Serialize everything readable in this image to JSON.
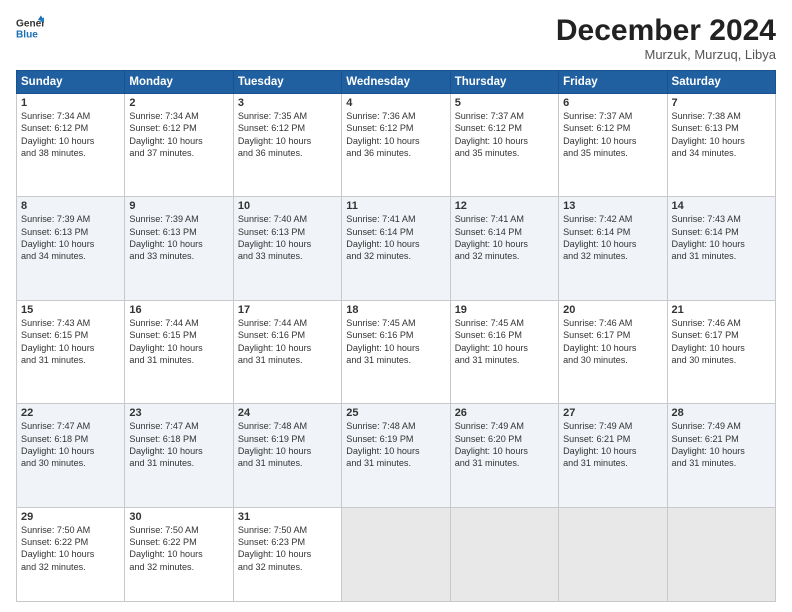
{
  "logo": {
    "line1": "General",
    "line2": "Blue"
  },
  "title": "December 2024",
  "location": "Murzuk, Murzuq, Libya",
  "days_header": [
    "Sunday",
    "Monday",
    "Tuesday",
    "Wednesday",
    "Thursday",
    "Friday",
    "Saturday"
  ],
  "weeks": [
    [
      {
        "day": "1",
        "info": "Sunrise: 7:34 AM\nSunset: 6:12 PM\nDaylight: 10 hours\nand 38 minutes."
      },
      {
        "day": "2",
        "info": "Sunrise: 7:34 AM\nSunset: 6:12 PM\nDaylight: 10 hours\nand 37 minutes."
      },
      {
        "day": "3",
        "info": "Sunrise: 7:35 AM\nSunset: 6:12 PM\nDaylight: 10 hours\nand 36 minutes."
      },
      {
        "day": "4",
        "info": "Sunrise: 7:36 AM\nSunset: 6:12 PM\nDaylight: 10 hours\nand 36 minutes."
      },
      {
        "day": "5",
        "info": "Sunrise: 7:37 AM\nSunset: 6:12 PM\nDaylight: 10 hours\nand 35 minutes."
      },
      {
        "day": "6",
        "info": "Sunrise: 7:37 AM\nSunset: 6:12 PM\nDaylight: 10 hours\nand 35 minutes."
      },
      {
        "day": "7",
        "info": "Sunrise: 7:38 AM\nSunset: 6:13 PM\nDaylight: 10 hours\nand 34 minutes."
      }
    ],
    [
      {
        "day": "8",
        "info": "Sunrise: 7:39 AM\nSunset: 6:13 PM\nDaylight: 10 hours\nand 34 minutes."
      },
      {
        "day": "9",
        "info": "Sunrise: 7:39 AM\nSunset: 6:13 PM\nDaylight: 10 hours\nand 33 minutes."
      },
      {
        "day": "10",
        "info": "Sunrise: 7:40 AM\nSunset: 6:13 PM\nDaylight: 10 hours\nand 33 minutes."
      },
      {
        "day": "11",
        "info": "Sunrise: 7:41 AM\nSunset: 6:14 PM\nDaylight: 10 hours\nand 32 minutes."
      },
      {
        "day": "12",
        "info": "Sunrise: 7:41 AM\nSunset: 6:14 PM\nDaylight: 10 hours\nand 32 minutes."
      },
      {
        "day": "13",
        "info": "Sunrise: 7:42 AM\nSunset: 6:14 PM\nDaylight: 10 hours\nand 32 minutes."
      },
      {
        "day": "14",
        "info": "Sunrise: 7:43 AM\nSunset: 6:14 PM\nDaylight: 10 hours\nand 31 minutes."
      }
    ],
    [
      {
        "day": "15",
        "info": "Sunrise: 7:43 AM\nSunset: 6:15 PM\nDaylight: 10 hours\nand 31 minutes."
      },
      {
        "day": "16",
        "info": "Sunrise: 7:44 AM\nSunset: 6:15 PM\nDaylight: 10 hours\nand 31 minutes."
      },
      {
        "day": "17",
        "info": "Sunrise: 7:44 AM\nSunset: 6:16 PM\nDaylight: 10 hours\nand 31 minutes."
      },
      {
        "day": "18",
        "info": "Sunrise: 7:45 AM\nSunset: 6:16 PM\nDaylight: 10 hours\nand 31 minutes."
      },
      {
        "day": "19",
        "info": "Sunrise: 7:45 AM\nSunset: 6:16 PM\nDaylight: 10 hours\nand 31 minutes."
      },
      {
        "day": "20",
        "info": "Sunrise: 7:46 AM\nSunset: 6:17 PM\nDaylight: 10 hours\nand 30 minutes."
      },
      {
        "day": "21",
        "info": "Sunrise: 7:46 AM\nSunset: 6:17 PM\nDaylight: 10 hours\nand 30 minutes."
      }
    ],
    [
      {
        "day": "22",
        "info": "Sunrise: 7:47 AM\nSunset: 6:18 PM\nDaylight: 10 hours\nand 30 minutes."
      },
      {
        "day": "23",
        "info": "Sunrise: 7:47 AM\nSunset: 6:18 PM\nDaylight: 10 hours\nand 31 minutes."
      },
      {
        "day": "24",
        "info": "Sunrise: 7:48 AM\nSunset: 6:19 PM\nDaylight: 10 hours\nand 31 minutes."
      },
      {
        "day": "25",
        "info": "Sunrise: 7:48 AM\nSunset: 6:19 PM\nDaylight: 10 hours\nand 31 minutes."
      },
      {
        "day": "26",
        "info": "Sunrise: 7:49 AM\nSunset: 6:20 PM\nDaylight: 10 hours\nand 31 minutes."
      },
      {
        "day": "27",
        "info": "Sunrise: 7:49 AM\nSunset: 6:21 PM\nDaylight: 10 hours\nand 31 minutes."
      },
      {
        "day": "28",
        "info": "Sunrise: 7:49 AM\nSunset: 6:21 PM\nDaylight: 10 hours\nand 31 minutes."
      }
    ],
    [
      {
        "day": "29",
        "info": "Sunrise: 7:50 AM\nSunset: 6:22 PM\nDaylight: 10 hours\nand 32 minutes."
      },
      {
        "day": "30",
        "info": "Sunrise: 7:50 AM\nSunset: 6:22 PM\nDaylight: 10 hours\nand 32 minutes."
      },
      {
        "day": "31",
        "info": "Sunrise: 7:50 AM\nSunset: 6:23 PM\nDaylight: 10 hours\nand 32 minutes."
      },
      {
        "day": "",
        "info": ""
      },
      {
        "day": "",
        "info": ""
      },
      {
        "day": "",
        "info": ""
      },
      {
        "day": "",
        "info": ""
      }
    ]
  ]
}
